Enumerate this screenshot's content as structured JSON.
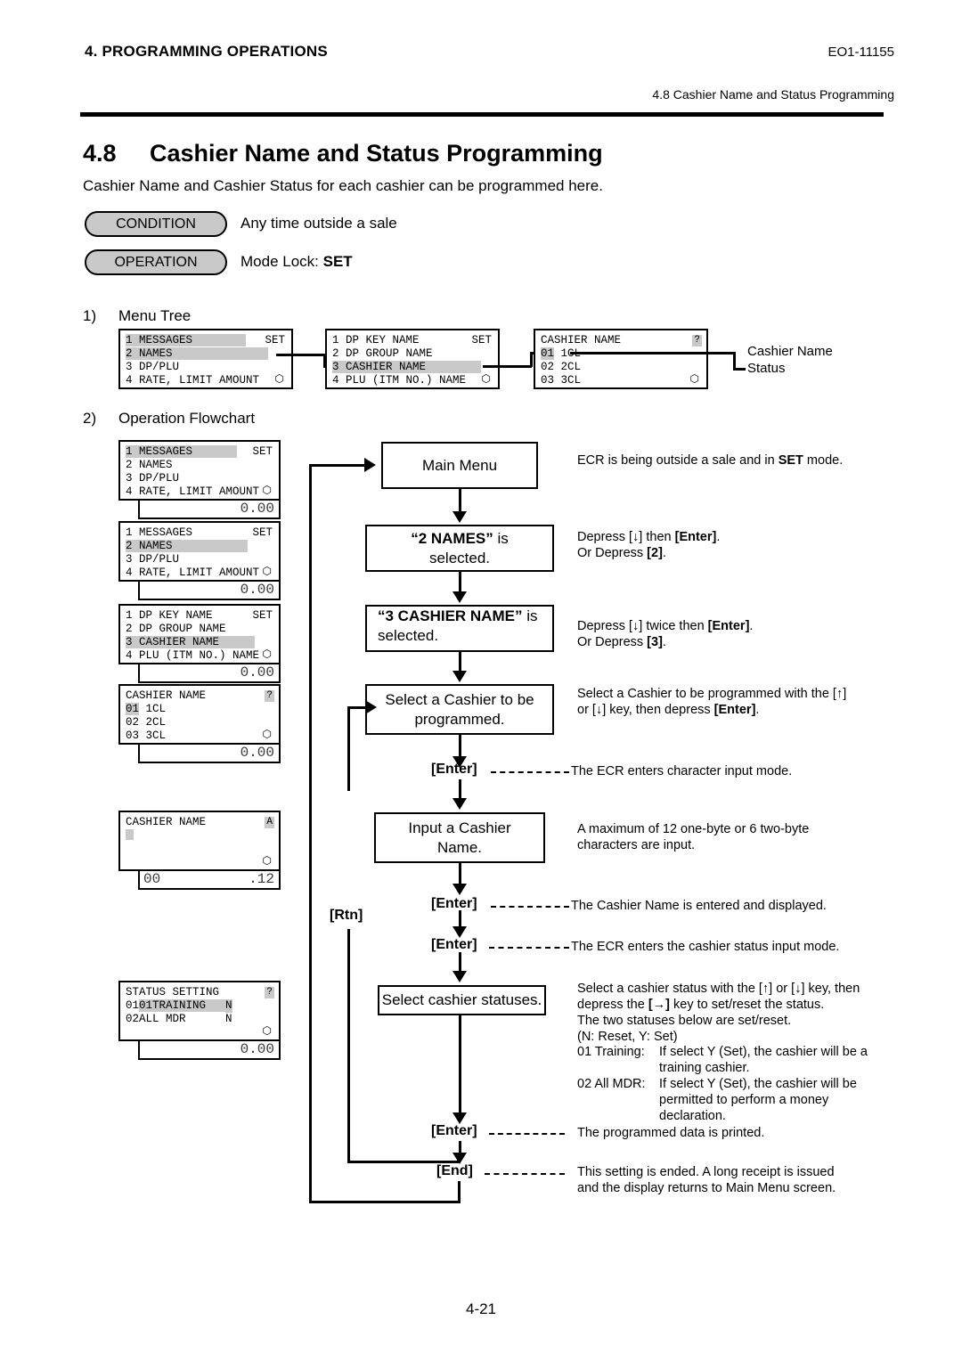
{
  "header": {
    "chapter": "4. PROGRAMMING OPERATIONS",
    "doc_code": "EO1-11155",
    "running_head": "4.8 Cashier Name and Status Programming"
  },
  "section": {
    "number": "4.8",
    "title": "Cashier Name and Status Programming",
    "intro": "Cashier Name and Cashier Status for each cashier can be programmed here.",
    "condition_label": "CONDITION",
    "condition_text": "Any time outside a sale",
    "operation_label": "OPERATION",
    "operation_text_prefix": "Mode Lock: ",
    "operation_text_bold": "SET"
  },
  "subsections": {
    "one_num": "1)",
    "one_label": "Menu Tree",
    "two_num": "2)",
    "two_label": "Operation Flowchart"
  },
  "menu_tree": {
    "panel1": {
      "rows": [
        "1 MESSAGES",
        "2 NAMES",
        "3 DP/PLU",
        "4 RATE, LIMIT AMOUNT"
      ],
      "corner": "SET",
      "highlight_index": 1
    },
    "panel2": {
      "rows": [
        "1 DP KEY NAME",
        "2 DP GROUP NAME",
        "3 CASHIER NAME",
        "4 PLU (ITM NO.) NAME"
      ],
      "corner": "SET",
      "highlight_index": 2
    },
    "panel3": {
      "title": "CASHIER NAME",
      "corner": "?",
      "rows": [
        "01 1CL",
        "02 2CL",
        "03 3CL"
      ],
      "highlight_index": 0
    },
    "callout_name": "Cashier Name",
    "callout_status": "Status"
  },
  "flow_displays": {
    "d1": {
      "rows": [
        "1 MESSAGES",
        "2 NAMES",
        "3 DP/PLU",
        "4 RATE, LIMIT AMOUNT"
      ],
      "corner": "SET",
      "highlight_index": 0,
      "sub": "0.00"
    },
    "d2": {
      "rows": [
        "1 MESSAGES",
        "2 NAMES",
        "3 DP/PLU",
        "4 RATE, LIMIT AMOUNT"
      ],
      "corner": "SET",
      "highlight_index": 1,
      "sub": "0.00"
    },
    "d3": {
      "rows": [
        "1 DP KEY NAME",
        "2 DP GROUP NAME",
        "3 CASHIER NAME",
        "4 PLU (ITM NO.) NAME"
      ],
      "corner": "SET",
      "highlight_index": 2,
      "sub": "0.00"
    },
    "d4": {
      "title": "CASHIER NAME",
      "corner": "?",
      "rows": [
        "01 1CL",
        "02 2CL",
        "03 3CL"
      ],
      "highlight_index": 0,
      "sub": "0.00"
    },
    "d5": {
      "title": "CASHIER NAME",
      "corner": "A",
      "sub_left": "00",
      "sub_right": ".12"
    },
    "d6": {
      "title": "STATUS SETTING",
      "corner": "?",
      "row1_label": "01TRAINING",
      "row1_value": "N",
      "row2_label": "02ALL MDR",
      "row2_value": "N",
      "sub": "0.00"
    }
  },
  "flow": {
    "box_main_menu": "Main Menu",
    "box_names_q": "“2 NAMES”",
    "box_names_rest": " is",
    "box_names_line2": "selected.",
    "box_cashier_q": "“3 CASHIER NAME”",
    "box_cashier_rest": " is",
    "box_cashier_line2": "selected.",
    "box_select_cashier_l1": "Select a Cashier to be",
    "box_select_cashier_l2": "programmed.",
    "box_input_name_l1": "Input a Cashier",
    "box_input_name_l2": "Name.",
    "box_select_status": "Select cashier statuses.",
    "key_enter": "[Enter]",
    "key_end": "[End]",
    "key_rtn": "[Rtn]"
  },
  "notes": {
    "n_main": "ECR is being outside a sale and in SET mode.",
    "n_main_bold": "SET",
    "n_names_l1_a": "Depress [↓] then ",
    "n_names_l1_b": "[Enter]",
    "n_names_l1_c": ".",
    "n_names_l2_a": "Or Depress ",
    "n_names_l2_b": "[2]",
    "n_names_l2_c": ".",
    "n_cashier_l1_a": "Depress [↓] twice then ",
    "n_cashier_l1_b": "[Enter]",
    "n_cashier_l1_c": ".",
    "n_cashier_l2_a": "Or Depress ",
    "n_cashier_l2_b": "[3]",
    "n_cashier_l2_c": ".",
    "n_select_l1": "Select a Cashier to be programmed with the [↑]",
    "n_select_l2_a": "or [↓] key, then depress ",
    "n_select_l2_b": "[Enter]",
    "n_select_l2_c": ".",
    "n_enter1": "The ECR enters character input mode.",
    "n_input_l1": "A   maximum   of   12   one-byte   or   6   two-byte",
    "n_input_l2": "characters are input.",
    "n_enter2": "The Cashier Name is entered and displayed.",
    "n_enter3": "The ECR enters the cashier status input mode.",
    "n_status_l1": "Select a cashier status with the [↑] or [↓] key, then",
    "n_status_l2_a": "depress the ",
    "n_status_l2_b": "[→]",
    "n_status_l2_c": " key to set/reset the status.",
    "n_status_l3": "The two statuses below are set/reset.",
    "n_status_l4": "(N: Reset, Y: Set)",
    "n_status_01_label": "01 Training:",
    "n_status_01_l1": "If select Y (Set), the cashier will be a",
    "n_status_01_l2": "training cashier.",
    "n_status_02_label": "02 All MDR:",
    "n_status_02_l1": "If select Y (Set), the cashier will be",
    "n_status_02_l2": "permitted to perform a money",
    "n_status_02_l3": "declaration.",
    "n_enter4": "The programmed data is printed.",
    "n_end_l1": "This setting is ended.   A long receipt is issued",
    "n_end_l2": "and the display returns to Main Menu screen."
  },
  "footer": {
    "page": "4-21"
  }
}
